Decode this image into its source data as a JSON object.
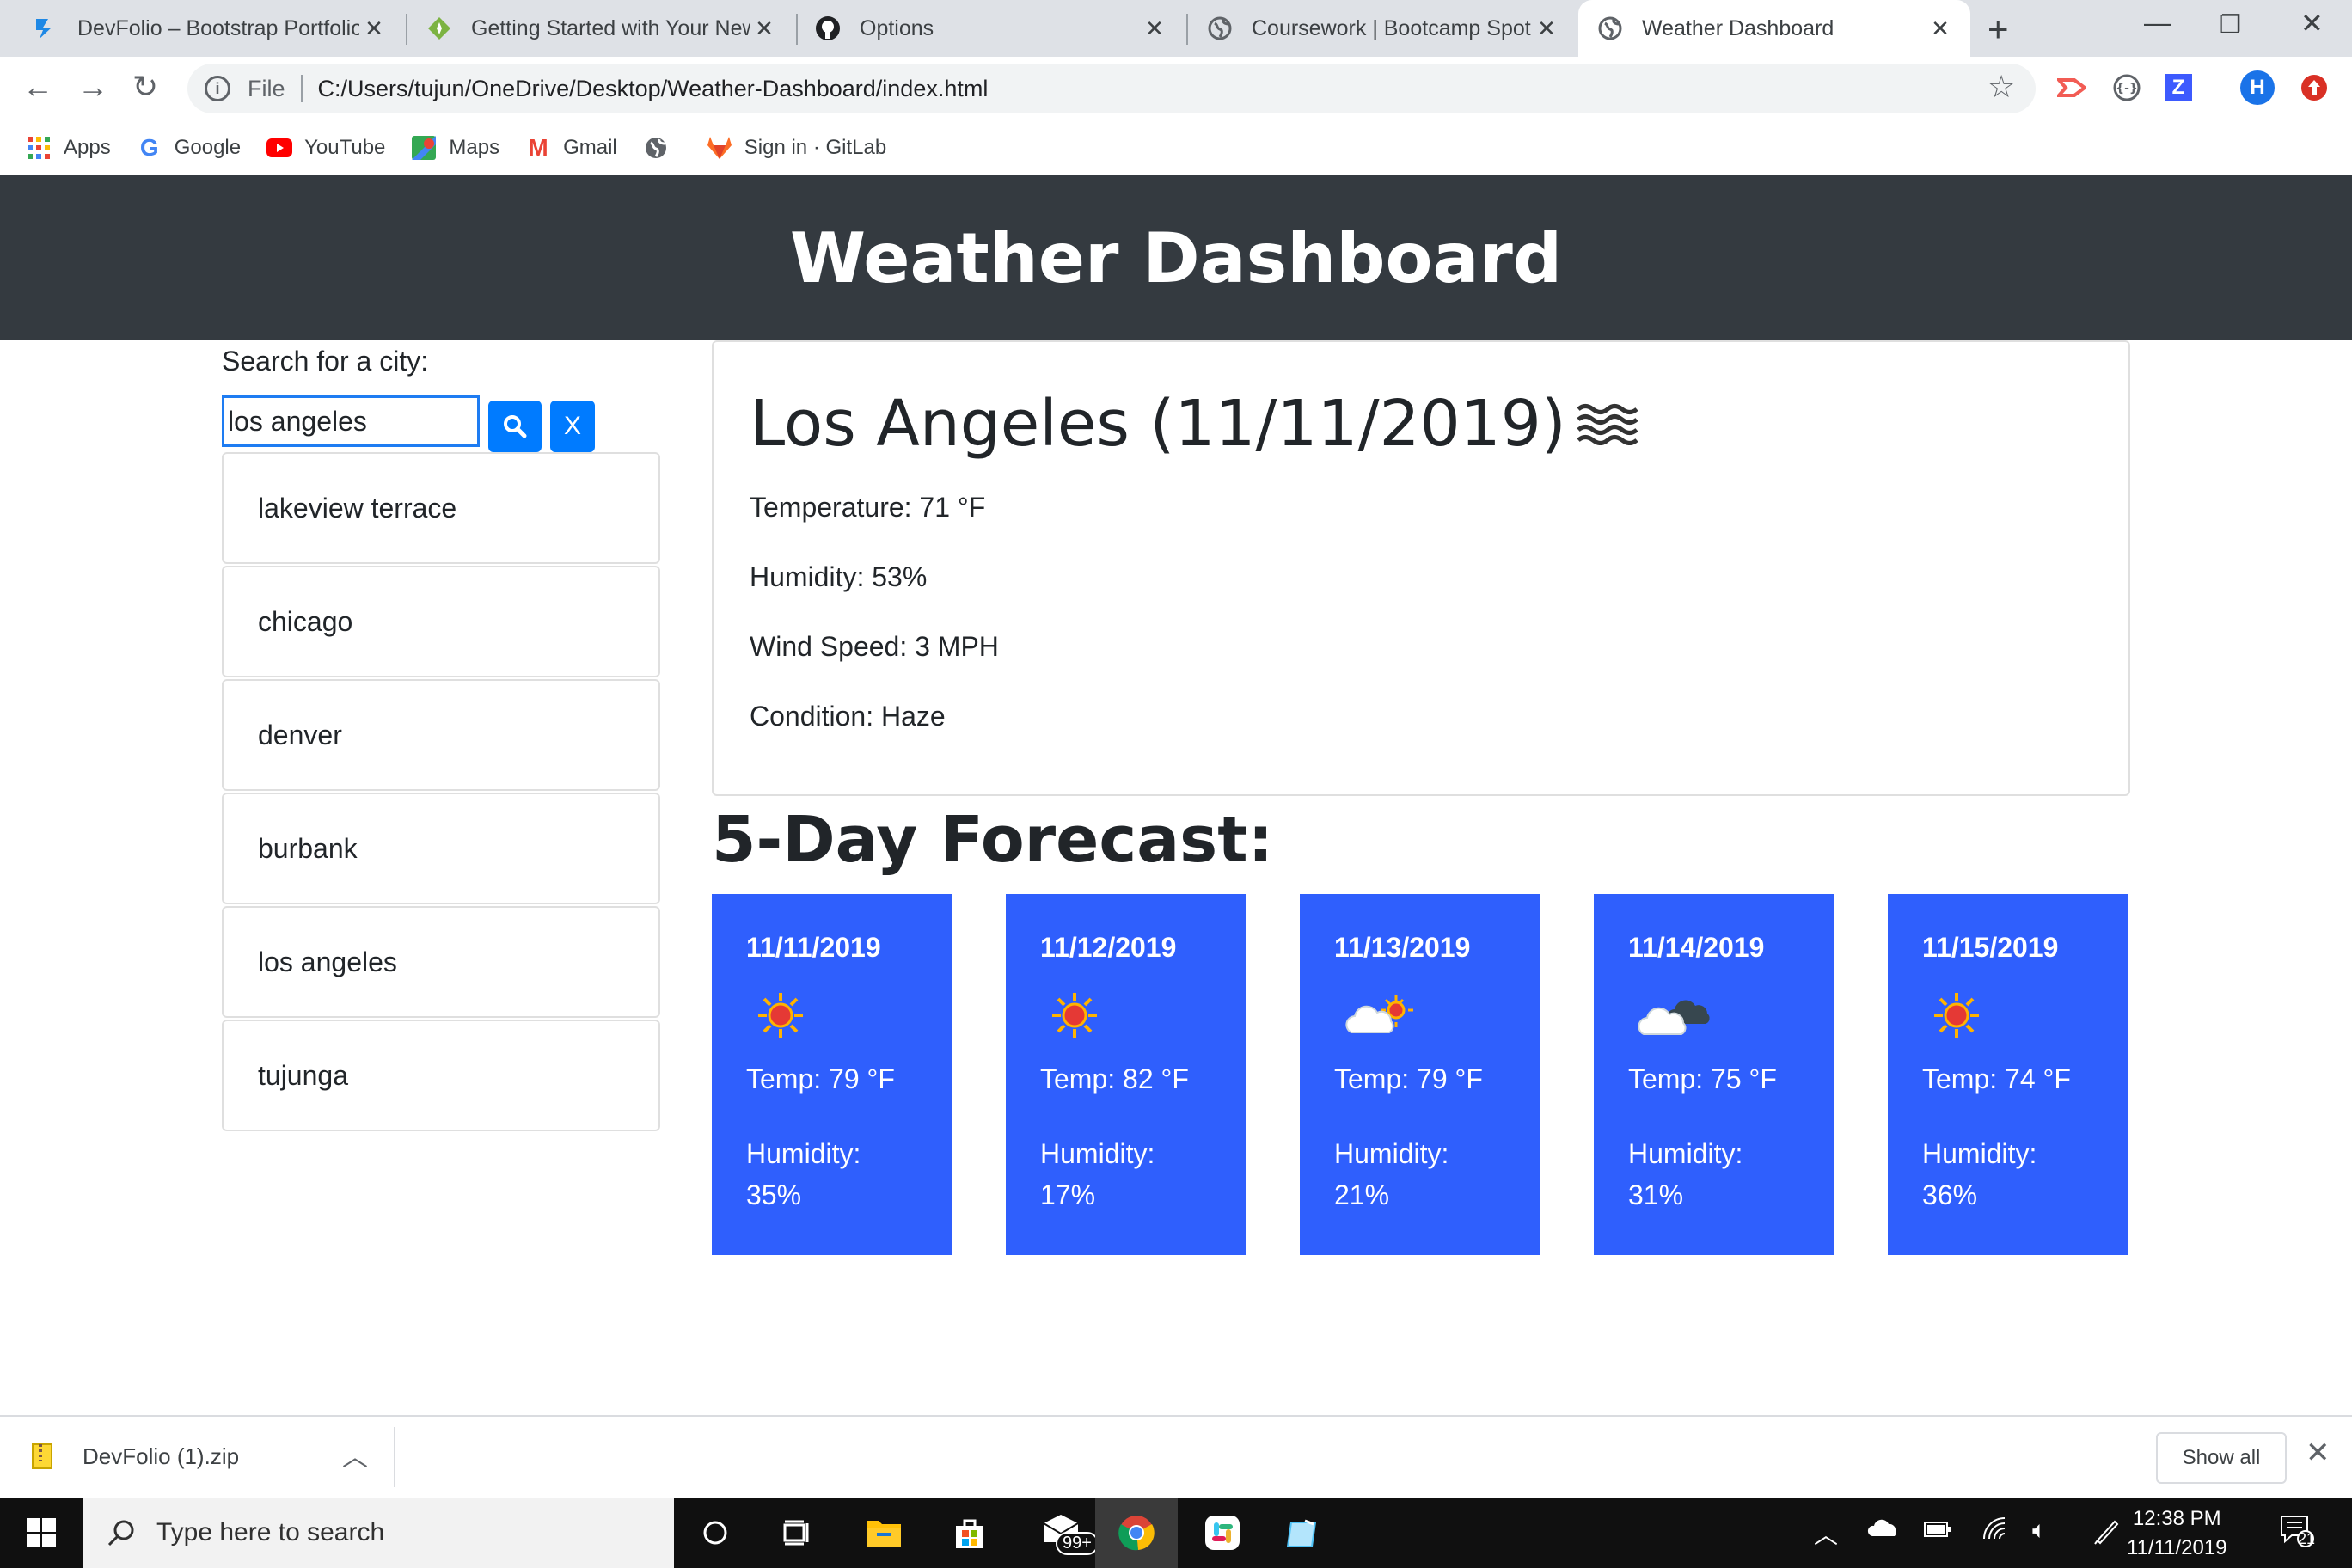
{
  "browser": {
    "tabs": [
      {
        "title": "DevFolio – Bootstrap Portfolio",
        "icon": "devfolio-icon",
        "active": false
      },
      {
        "title": "Getting Started with Your New",
        "icon": "gitlab-diamond-icon",
        "active": false
      },
      {
        "title": "Options",
        "icon": "github-icon",
        "active": false
      },
      {
        "title": "Coursework | Bootcamp Spot",
        "icon": "globe-icon",
        "active": false
      },
      {
        "title": "Weather Dashboard",
        "icon": "globe-icon",
        "active": true
      }
    ],
    "address": {
      "scheme": "File",
      "url": "C:/Users/tujun/OneDrive/Desktop/Weather-Dashboard/index.html"
    },
    "profile_initial": "H",
    "bookmarks": [
      {
        "label": "Apps",
        "icon": "apps-grid-icon"
      },
      {
        "label": "Google",
        "icon": "google-icon"
      },
      {
        "label": "YouTube",
        "icon": "youtube-icon"
      },
      {
        "label": "Maps",
        "icon": "maps-icon"
      },
      {
        "label": "Gmail",
        "icon": "gmail-icon"
      },
      {
        "label": "",
        "icon": "globe-icon"
      },
      {
        "label": "Sign in · GitLab",
        "icon": "gitlab-icon"
      }
    ]
  },
  "page": {
    "header_title": "Weather Dashboard",
    "search": {
      "label": "Search for a city:",
      "value": "los angeles",
      "clear_label": "X"
    },
    "history": [
      "lakeview terrace",
      "chicago",
      "denver",
      "burbank",
      "los angeles",
      "tujunga"
    ],
    "current": {
      "heading": "Los Angeles (11/11/2019)",
      "icon": "haze-icon",
      "temperature": "Temperature: 71 °F",
      "humidity": "Humidity: 53%",
      "wind": "Wind Speed: 3 MPH",
      "condition": "Condition: Haze"
    },
    "forecast_title": "5-Day Forecast:",
    "forecast": [
      {
        "date": "11/11/2019",
        "icon": "sun-icon",
        "temp": "Temp: 79 °F",
        "humidity": "Humidity: 35%"
      },
      {
        "date": "11/12/2019",
        "icon": "sun-icon",
        "temp": "Temp: 82 °F",
        "humidity": "Humidity: 17%"
      },
      {
        "date": "11/13/2019",
        "icon": "partly-cloudy-icon",
        "temp": "Temp: 79 °F",
        "humidity": "Humidity: 21%"
      },
      {
        "date": "11/14/2019",
        "icon": "cloudy-icon",
        "temp": "Temp: 75 °F",
        "humidity": "Humidity: 31%"
      },
      {
        "date": "11/15/2019",
        "icon": "sun-icon",
        "temp": "Temp: 74 °F",
        "humidity": "Humidity: 36%"
      }
    ]
  },
  "downloads": {
    "file": "DevFolio (1).zip",
    "show_all": "Show all"
  },
  "taskbar": {
    "search_placeholder": "Type here to search",
    "mail_badge": "99+",
    "time": "12:38 PM",
    "date": "11/11/2019",
    "notification_count": "21"
  },
  "colors": {
    "header": "#343a40",
    "card": "#2f5ffd",
    "button": "#007bff"
  }
}
